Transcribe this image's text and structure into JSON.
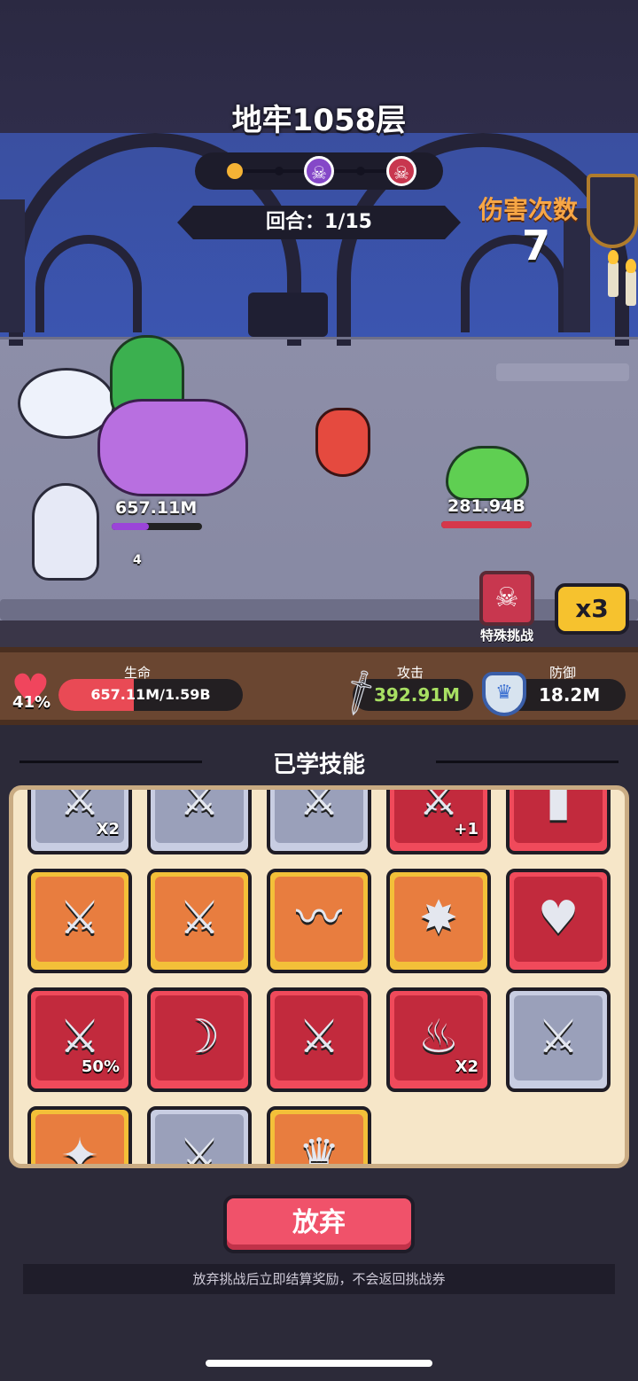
{
  "header": {
    "title": "地牢1058层",
    "round_text": "回合：1/15",
    "hit_count_label": "伤害次数",
    "hit_count_value": "7"
  },
  "stage_progress": {
    "current_node_color": "#f5b335",
    "mini_boss_icon": "purple-skull-icon",
    "boss_icon": "red-skull-icon"
  },
  "party": {
    "hp_text": "657.11M",
    "hp_fraction": 0.41,
    "summon_count": "4"
  },
  "enemy": {
    "hp_text": "281.94B",
    "hp_fraction": 1.0
  },
  "special_challenge": {
    "label": "特殊挑战",
    "icon": "demon-skull-icon"
  },
  "speed_button": {
    "label": "x3"
  },
  "stats": {
    "life_label": "生命",
    "life_percent": "41%",
    "life_fraction": 0.41,
    "life_text": "657.11M/1.59B",
    "attack_label": "攻击",
    "attack_value": "392.91M",
    "defense_label": "防御",
    "defense_value": "18.2M"
  },
  "skills": {
    "title": "已学技能",
    "rows": [
      [
        {
          "theme": "gray",
          "icon": "sword-double-icon",
          "tag": "X2"
        },
        {
          "theme": "gray",
          "icon": "sword-percent-icon",
          "tag": ""
        },
        {
          "theme": "gray",
          "icon": "sword-wave-icon",
          "tag": ""
        },
        {
          "theme": "red",
          "icon": "sword-plus-one-icon",
          "tag": "+1"
        },
        {
          "theme": "red",
          "icon": "tombstone-icon",
          "tag": ""
        }
      ],
      [
        {
          "theme": "gold",
          "icon": "sword-dash-icon",
          "tag": ""
        },
        {
          "theme": "gold",
          "icon": "sword-skeleton-icon",
          "tag": ""
        },
        {
          "theme": "gold",
          "icon": "water-wave-plus-icon",
          "tag": ""
        },
        {
          "theme": "gold",
          "icon": "sword-burst-icon",
          "tag": ""
        },
        {
          "theme": "red",
          "icon": "double-heart-up-icon",
          "tag": ""
        }
      ],
      [
        {
          "theme": "red",
          "icon": "sword-heart-50-icon",
          "tag": "50%"
        },
        {
          "theme": "red",
          "icon": "red-slash-icon",
          "tag": ""
        },
        {
          "theme": "red",
          "icon": "sword-up-arrow-icon",
          "tag": ""
        },
        {
          "theme": "red",
          "icon": "fire-icon",
          "tag": "X2"
        },
        {
          "theme": "gray",
          "icon": "sword-frost-icon",
          "tag": ""
        }
      ],
      [
        {
          "theme": "gold",
          "icon": "spell-book-icon",
          "tag": ""
        },
        {
          "theme": "gray",
          "icon": "broken-sword-icon",
          "tag": ""
        },
        {
          "theme": "gold",
          "icon": "crown-icon",
          "tag": ""
        }
      ]
    ]
  },
  "actions": {
    "abandon_label": "放弃",
    "notice": "放弃挑战后立即结算奖励，不会返回挑战券"
  }
}
